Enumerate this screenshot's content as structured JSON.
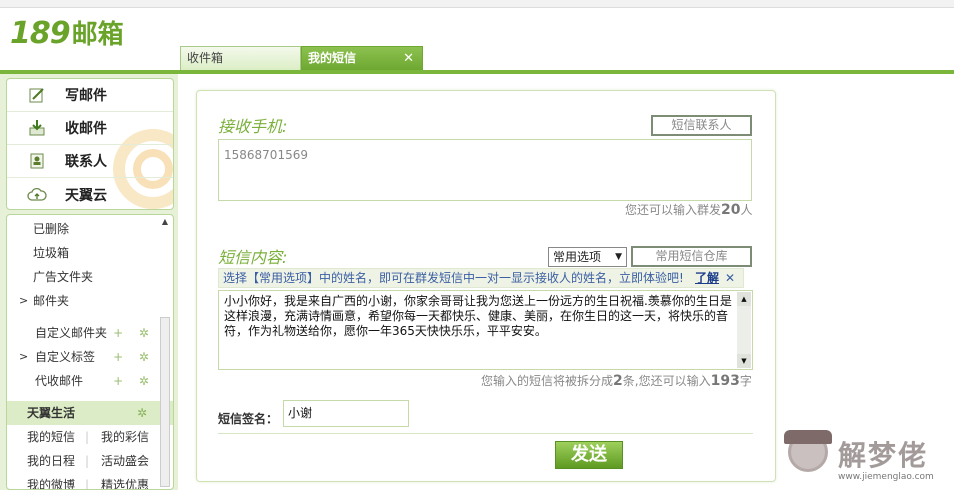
{
  "brand": {
    "logo_num": "189",
    "logo_cn": "邮箱"
  },
  "tabs": [
    {
      "label": "收件箱",
      "active": false
    },
    {
      "label": "我的短信",
      "active": true,
      "close": "✕"
    }
  ],
  "quick_actions": [
    {
      "label": "写邮件",
      "icon": "compose-icon"
    },
    {
      "label": "收邮件",
      "icon": "receive-icon"
    },
    {
      "label": "联系人",
      "icon": "contacts-icon"
    },
    {
      "label": "天翼云",
      "icon": "cloud-icon"
    }
  ],
  "folders": {
    "items": [
      "已删除",
      "垃圾箱",
      "广告文件夹",
      "邮件夹"
    ],
    "custom": [
      "自定义邮件夹",
      "自定义标签",
      "代收邮件"
    ],
    "actions": "+ ✲"
  },
  "life": {
    "title": "天翼生活",
    "gear": "✲",
    "pairs": [
      [
        "我的短信",
        "我的彩信"
      ],
      [
        "我的日程",
        "活动盛会"
      ],
      [
        "我的微博",
        "精选优惠"
      ]
    ]
  },
  "sms": {
    "recipient_title": "接收手机:",
    "contacts_button": "短信联系人",
    "recipient_value": "15868701569",
    "group_hint_prefix": "您还可以输入群发",
    "group_hint_count": "20",
    "group_hint_suffix": "人",
    "content_title": "短信内容:",
    "options_select": "常用选项",
    "library_button": "常用短信仓库",
    "tip": "选择【常用选项】中的姓名，即可在群发短信中一对一显示接收人的姓名，立即体验吧!",
    "tip_link": "了解",
    "tip_close": "✕",
    "message": "小小你好，我是来自广西的小谢，你家余哥哥让我为您送上一份远方的生日祝福.羡慕你的生日是这样浪漫，充满诗情画意，希望你每一天都快乐、健康、美丽，在你生日的这一天，将快乐的音符，作为礼物送给你，愿你一年365天快快乐乐，平平安安。",
    "split_prefix": "您输入的短信将被拆分成",
    "split_count": "2",
    "split_mid": "条,您还可以输入",
    "remaining": "193",
    "remaining_suffix": "字",
    "signature_label": "短信签名：",
    "signature_value": "小谢",
    "send_button": "发送"
  },
  "watermark": {
    "text": "解梦佬",
    "url": "www.jiemenglao.com"
  },
  "colors": {
    "brand_green": "#6aa32a",
    "accent_green": "#7bb63c",
    "title_green": "#7ab03a"
  }
}
